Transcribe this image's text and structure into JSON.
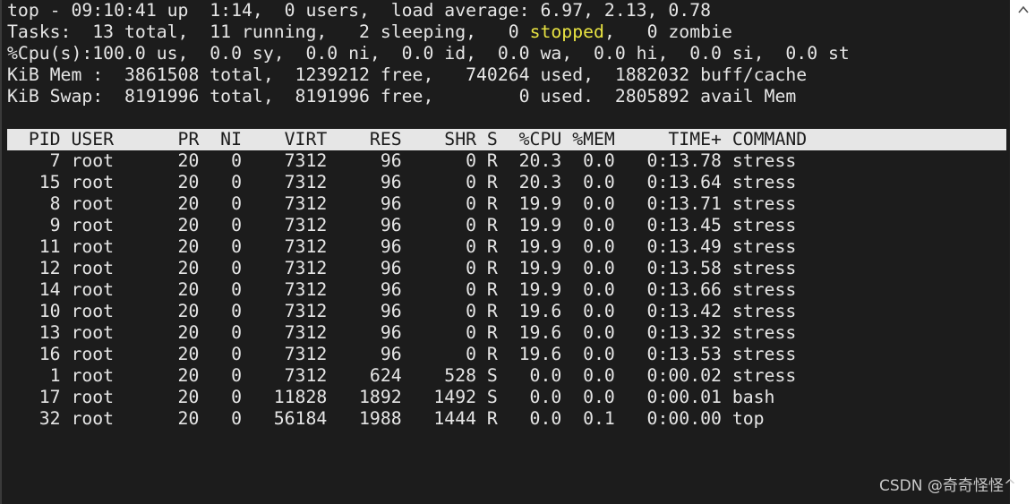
{
  "summary": {
    "line1": "top - 09:10:41 up  1:14,  0 users,  load average: 6.97, 2.13, 0.78",
    "tasks_before": "Tasks:  13 total,  11 running,   2 sleeping,   0 ",
    "tasks_stopped": "stopped",
    "tasks_after": ",   0 zombie",
    "cpu": "%Cpu(s):100.0 us,  0.0 sy,  0.0 ni,  0.0 id,  0.0 wa,  0.0 hi,  0.0 si,  0.0 st",
    "mem": "KiB Mem :  3861508 total,  1239212 free,   740264 used,  1882032 buff/cache",
    "swap": "KiB Swap:  8191996 total,  8191996 free,        0 used.  2805892 avail Mem"
  },
  "table": {
    "header": "  PID USER      PR  NI    VIRT    RES    SHR S  %CPU %MEM     TIME+ COMMAND",
    "rows": [
      "    7 root      20   0    7312     96      0 R  20.3  0.0   0:13.78 stress",
      "   15 root      20   0    7312     96      0 R  20.3  0.0   0:13.64 stress",
      "    8 root      20   0    7312     96      0 R  19.9  0.0   0:13.71 stress",
      "    9 root      20   0    7312     96      0 R  19.9  0.0   0:13.45 stress",
      "   11 root      20   0    7312     96      0 R  19.9  0.0   0:13.49 stress",
      "   12 root      20   0    7312     96      0 R  19.9  0.0   0:13.58 stress",
      "   14 root      20   0    7312     96      0 R  19.9  0.0   0:13.66 stress",
      "   10 root      20   0    7312     96      0 R  19.6  0.0   0:13.42 stress",
      "   13 root      20   0    7312     96      0 R  19.6  0.0   0:13.32 stress",
      "   16 root      20   0    7312     96      0 R  19.6  0.0   0:13.53 stress",
      "    1 root      20   0    7312    624    528 S   0.0  0.0   0:00.02 stress",
      "   17 root      20   0   11828   1892   1492 S   0.0  0.0   0:00.01 bash",
      "   32 root      20   0   56184   1988   1444 R   0.0  0.1   0:00.00 top"
    ]
  },
  "watermark": "CSDN @奇奇怪怪^",
  "icons": {
    "scroll_up": "chevron-up-icon"
  },
  "colors": {
    "background": "#1c1c1c",
    "foreground": "#e6e6e6",
    "header_bg": "#e6e6e6",
    "stopped_highlight": "#e8e342"
  }
}
